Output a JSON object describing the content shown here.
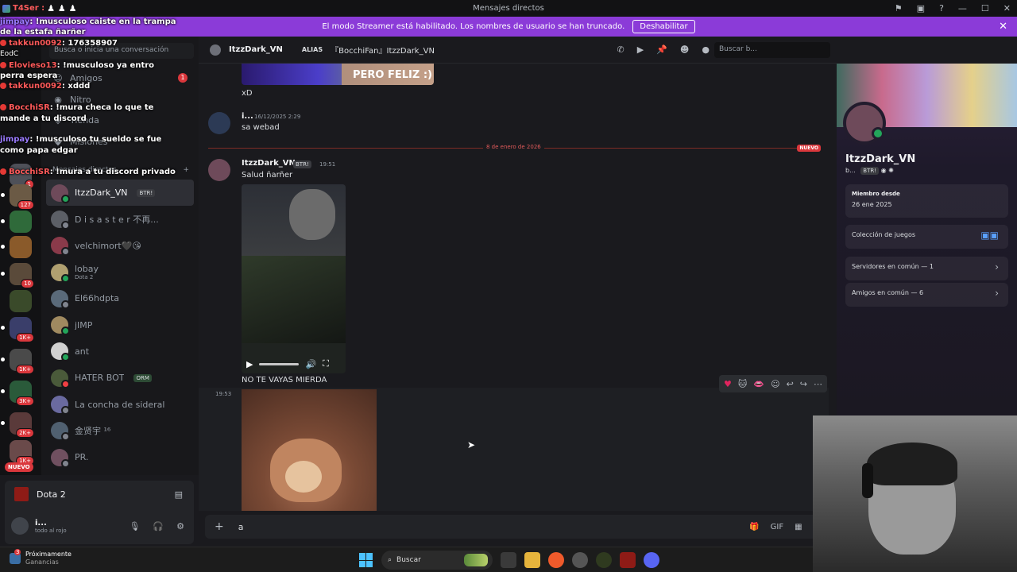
{
  "titlebar": {
    "title": "Mensajes directos",
    "streamer_tag": "T4Ser :",
    "chess_glyphs": "♟ ♟ ♟"
  },
  "banner": {
    "text": "El modo Streamer está habilitado. Los nombres de usuario se han truncado.",
    "button": "Deshabilitar",
    "close": "✕"
  },
  "overlay_chat": [
    {
      "user": "jimpay",
      "text": ": !musculoso caiste en la trampa"
    },
    {
      "user": "",
      "text": "de la estafa ñarñer"
    },
    {
      "user": "takkun0092",
      "text": ": 176358907"
    },
    {
      "user": "",
      "text": "EodC"
    },
    {
      "user": "Elovieso13",
      "text": ": !musculoso ya entro"
    },
    {
      "user": "",
      "text": "perra espera"
    },
    {
      "user": "takkun0092",
      "text": ": xddd"
    },
    {
      "user": "",
      "text": ""
    },
    {
      "user": "BocchiSR",
      "text": ": !mura checa lo que te"
    },
    {
      "user": "",
      "text": "mande a tu discord"
    },
    {
      "user": "",
      "text": ""
    },
    {
      "user": "jimpay",
      "text": ": !musculoso tu sueldo se fue"
    },
    {
      "user": "",
      "text": "como papa edgar"
    },
    {
      "user": "",
      "text": ""
    },
    {
      "user": "BocchiSR",
      "text": ": !mura a tu discord privado"
    }
  ],
  "rail": {
    "badges": [
      "1",
      "127",
      "10",
      "1K+",
      "1K+",
      "3K+",
      "2K+",
      "1K+"
    ],
    "nuevo": "NUEVO"
  },
  "sidebar": {
    "search_placeholder": "Busca o inicia una conversación",
    "nav": [
      {
        "label": "Amigos",
        "count": "1"
      },
      {
        "label": "Nitro"
      },
      {
        "label": "Tienda"
      },
      {
        "label": "Misiones"
      }
    ],
    "dm_header": "Mensajes directos",
    "dm_add": "+",
    "dms": [
      {
        "name": "ItzzDark_VN",
        "tag": "BTR!",
        "status": "on",
        "active": true
      },
      {
        "name": "D i s a s t e r 不再...",
        "status": "off"
      },
      {
        "name": "velchimort🖤😘",
        "status": "off"
      },
      {
        "name": "lobay",
        "sub": "Dota 2",
        "status": "on"
      },
      {
        "name": "El66hdpta",
        "status": "off"
      },
      {
        "name": "jIMP",
        "status": "on"
      },
      {
        "name": "ant",
        "status": "on"
      },
      {
        "name": "HATER BOT",
        "tag": "ORM",
        "status": "dnd"
      },
      {
        "name": "La concha de sideral",
        "status": "off"
      },
      {
        "name": "金贤宇 ¹⁶",
        "status": "off"
      },
      {
        "name": "PR.",
        "status": "off"
      }
    ]
  },
  "game": {
    "name": "Dota 2"
  },
  "user": {
    "name": "i...",
    "status": "todo al rojo"
  },
  "chat": {
    "header_name": "ItzzDark_VN",
    "alias_label": "ALIAS",
    "alias_value": "『BocchiFan』ItzzDark_VN",
    "search_placeholder": "Buscar b...",
    "image_caption": "PERO FELIZ :)",
    "msg_xd": "xD",
    "msg2_user": "i...",
    "msg2_time": "16/12/2025 2:29",
    "msg2_text": "sa webad",
    "divider_date": "8 de enero de 2026",
    "divider_new": "NUEVO",
    "msg3_user": "ItzzDark_VN",
    "msg3_tag": "BTR!",
    "msg3_time": "19:51",
    "msg3_text": "Salud ñarñer",
    "msg3_text2": "NO TE VAYAS MIERDA",
    "msg4_time": "19:53",
    "composer_value": "a"
  },
  "profile": {
    "name": "ItzzDark_VN",
    "sub": "b...",
    "tag": "BTR!",
    "member_since_label": "Miembro desde",
    "member_since": "26 ene 2025",
    "games_label": "Colección de juegos",
    "servers": "Servidores en común — 1",
    "friends": "Amigos en común — 6"
  },
  "taskbar": {
    "weather_title": "Próximamente",
    "weather_sub": "Ganancias",
    "weather_badge": "3",
    "search": "Buscar"
  }
}
